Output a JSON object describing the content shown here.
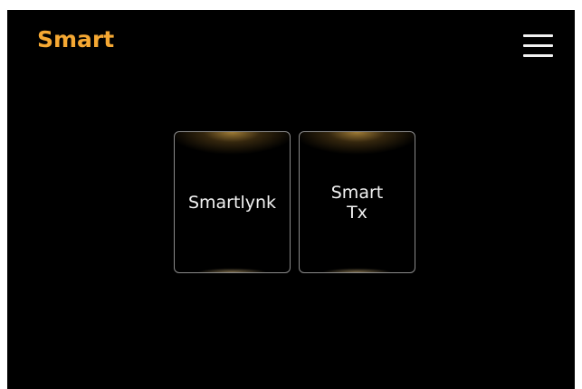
{
  "header": {
    "title": "Smart",
    "title_color": "#f5a833",
    "menu_icon": "hamburger-menu-icon"
  },
  "tiles": [
    {
      "label": "Smartlynk"
    },
    {
      "label": "Smart\nTx"
    }
  ],
  "colors": {
    "background": "#000000",
    "tile_border": "#8a8a8a",
    "tile_glow": "#d6a648",
    "text": "#f2f2f2"
  }
}
